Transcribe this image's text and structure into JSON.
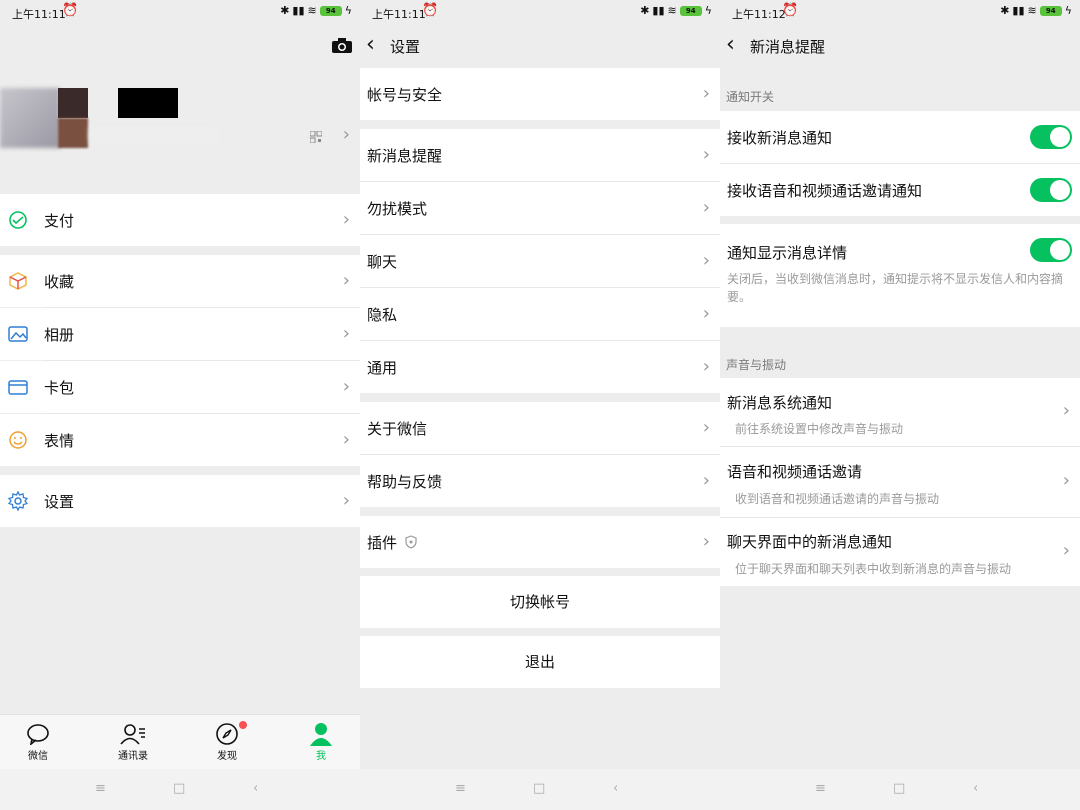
{
  "status": {
    "p1_time": "上午11:11",
    "p2_time": "上午11:11",
    "p3_time": "上午11:12",
    "battery": "94"
  },
  "profile": {
    "camera": "camera-icon"
  },
  "me_menu": {
    "pay": "支付",
    "favorites": "收藏",
    "album": "相册",
    "cards": "卡包",
    "stickers": "表情",
    "settings": "设置"
  },
  "tabs": [
    {
      "label": "微信",
      "icon": "chat-bubble-icon"
    },
    {
      "label": "通讯录",
      "icon": "contacts-icon"
    },
    {
      "label": "发现",
      "icon": "compass-icon"
    },
    {
      "label": "我",
      "icon": "person-icon"
    }
  ],
  "settings": {
    "title": "设置",
    "items": [
      "帐号与安全",
      "新消息提醒",
      "勿扰模式",
      "聊天",
      "隐私",
      "通用",
      "关于微信",
      "帮助与反馈",
      "插件"
    ],
    "switch_account": "切换帐号",
    "logout": "退出"
  },
  "notify": {
    "title": "新消息提醒",
    "section1": "通知开关",
    "receive_new": "接收新消息通知",
    "receive_call": "接收语音和视频通话邀请通知",
    "show_detail": "通知显示消息详情",
    "show_detail_desc": "关闭后，当收到微信消息时，通知提示将不显示发信人和内容摘要。",
    "section2": "声音与振动",
    "sys_notify": "新消息系统通知",
    "sys_notify_desc": "前往系统设置中修改声音与振动",
    "call_invite": "语音和视频通话邀请",
    "call_invite_desc": "收到语音和视频通话邀请的声音与振动",
    "chat_notify": "聊天界面中的新消息通知",
    "chat_notify_desc": "位于聊天界面和聊天列表中收到新消息的声音与振动"
  },
  "colors": {
    "accent": "#07c160",
    "background": "#ededed"
  }
}
